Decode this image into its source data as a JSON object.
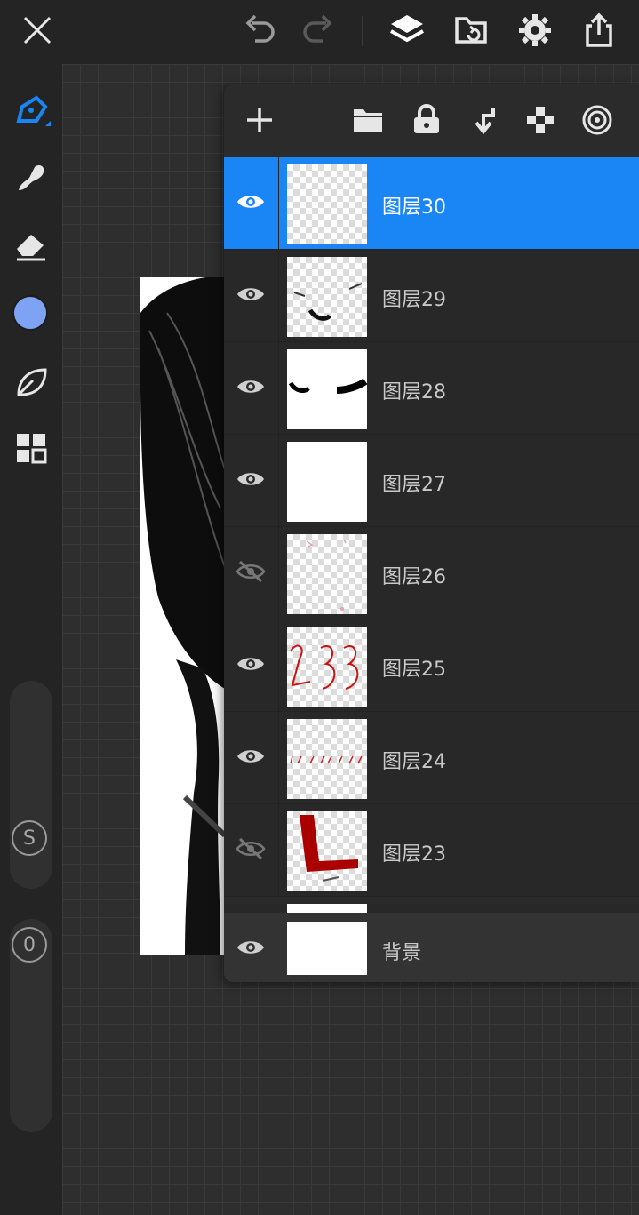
{
  "colors": {
    "accent": "#1a86f5",
    "brush_color": "#7ea2f4",
    "toolbar_bg": "#242424",
    "panel_bg": "#2b2b2b"
  },
  "topbar": {
    "icons": [
      "close-icon",
      "undo-icon",
      "redo-icon",
      "layers-icon",
      "import-icon",
      "settings-icon",
      "share-icon"
    ]
  },
  "sidebar": {
    "tools": [
      "brush-icon",
      "smudge-icon",
      "eraser-icon",
      "color-swatch",
      "leaf-icon",
      "grid-icon"
    ],
    "size_badge": "S",
    "opacity_badge": "0"
  },
  "layers_panel": {
    "toolbar_icons": [
      "add-layer-icon",
      "folder-icon",
      "lock-icon",
      "merge-down-icon",
      "transparency-icon",
      "target-icon"
    ],
    "layers": [
      {
        "name": "图层30",
        "visible": true,
        "selected": true
      },
      {
        "name": "图层29",
        "visible": true,
        "selected": false
      },
      {
        "name": "图层28",
        "visible": true,
        "selected": false
      },
      {
        "name": "图层27",
        "visible": true,
        "selected": false
      },
      {
        "name": "图层26",
        "visible": false,
        "selected": false
      },
      {
        "name": "图层25",
        "visible": true,
        "selected": false
      },
      {
        "name": "图层24",
        "visible": true,
        "selected": false
      },
      {
        "name": "图层23",
        "visible": false,
        "selected": false
      }
    ],
    "background": {
      "name": "背景",
      "visible": true
    }
  }
}
